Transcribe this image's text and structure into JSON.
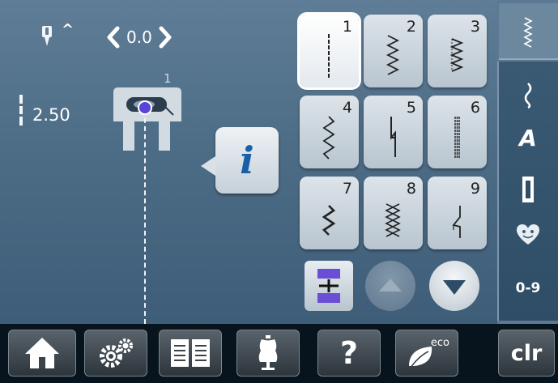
{
  "needle": {
    "position_value": "0.0",
    "up_glyph": "^"
  },
  "stitch_length": {
    "value": "2.50"
  },
  "presser_foot": {
    "number": "1"
  },
  "info_button": {
    "glyph": "i"
  },
  "stitches": [
    {
      "number": "1",
      "selected": true,
      "icon": "straight-stitch-icon"
    },
    {
      "number": "2",
      "selected": false,
      "icon": "zigzag-stitch-icon"
    },
    {
      "number": "3",
      "selected": false,
      "icon": "vari-overlock-stitch-icon"
    },
    {
      "number": "4",
      "selected": false,
      "icon": "running-stitch-icon"
    },
    {
      "number": "5",
      "selected": false,
      "icon": "securing-stitch-icon"
    },
    {
      "number": "6",
      "selected": false,
      "icon": "triple-straight-stitch-icon"
    },
    {
      "number": "7",
      "selected": false,
      "icon": "triple-zigzag-stitch-icon"
    },
    {
      "number": "8",
      "selected": false,
      "icon": "honeycomb-stitch-icon"
    },
    {
      "number": "9",
      "selected": false,
      "icon": "blind-stitch-icon"
    }
  ],
  "sidebar": {
    "items": [
      {
        "icon": "practical-stitches-icon"
      },
      {
        "icon": "decorative-stitches-icon"
      },
      {
        "label": "A",
        "icon": "alphabets-icon"
      },
      {
        "icon": "buttonholes-icon"
      },
      {
        "icon": "personal-program-heart-icon"
      },
      {
        "label": "0-9",
        "icon": "direct-selection-icon"
      }
    ]
  },
  "bottom_bar": {
    "help_label": "?",
    "eco_label": "eco",
    "clear_label": "clr"
  },
  "colors": {
    "screen_top": "#5f7d96",
    "screen_bottom": "#3e5d78",
    "tile": "#c9d3dc",
    "selected_tile": "#ffffff",
    "info_glyph": "#1a5fa8",
    "accent_purple": "#6a4fd6"
  }
}
